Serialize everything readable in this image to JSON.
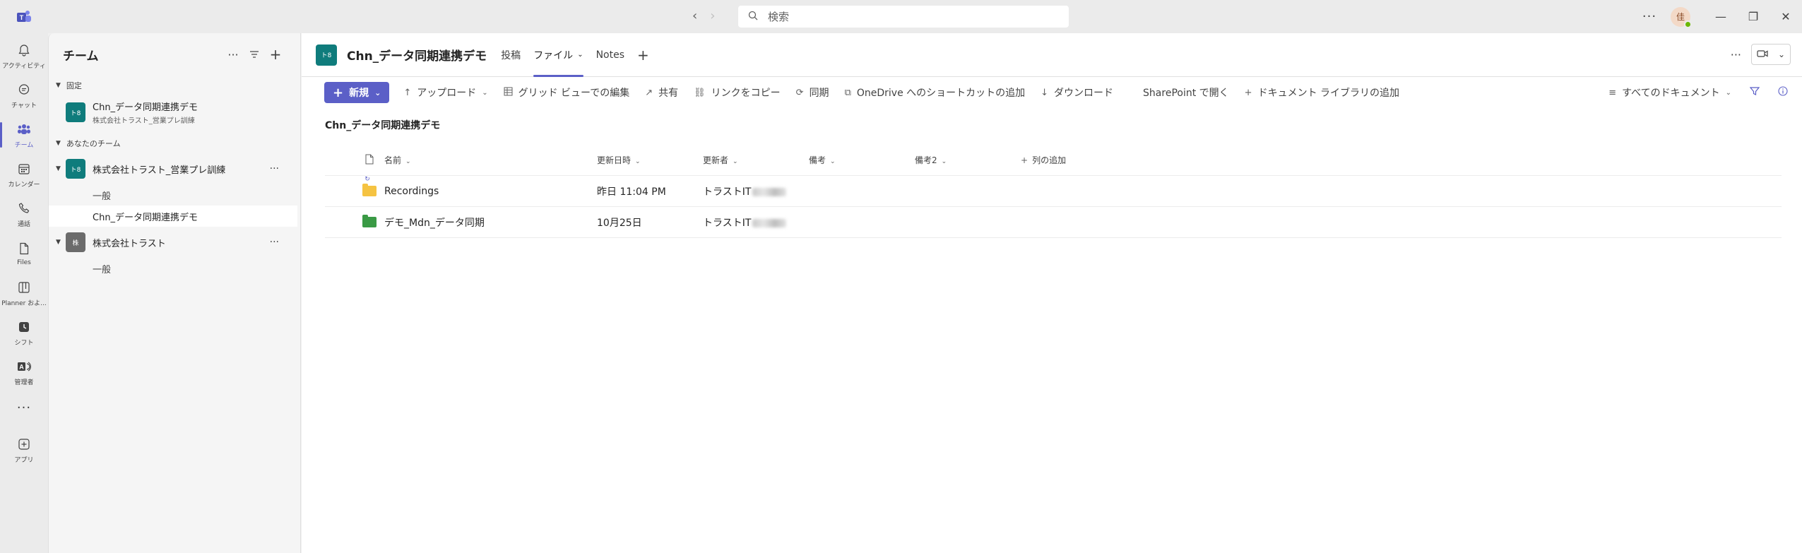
{
  "titlebar": {
    "search_placeholder": "検索",
    "avatar_initial": "佳"
  },
  "rail": [
    {
      "label": "アクティビティ",
      "icon": "bell-icon"
    },
    {
      "label": "チャット",
      "icon": "chat-icon"
    },
    {
      "label": "チーム",
      "icon": "teams-icon",
      "active": true
    },
    {
      "label": "カレンダー",
      "icon": "calendar-icon"
    },
    {
      "label": "通話",
      "icon": "phone-icon"
    },
    {
      "label": "Files",
      "icon": "file-icon"
    },
    {
      "label": "Planner およ...",
      "icon": "planner-icon"
    },
    {
      "label": "シフト",
      "icon": "shifts-icon"
    },
    {
      "label": "管理者",
      "icon": "admin-icon"
    },
    {
      "label": "",
      "icon": "more-icon"
    },
    {
      "label": "アプリ",
      "icon": "apps-icon"
    }
  ],
  "teams_panel": {
    "title": "チーム",
    "pinned_label": "固定",
    "pinned": {
      "avatar": "ト8",
      "name": "Chn_データ同期連携デモ",
      "sub": "株式会社トラスト_営業プレ訓練"
    },
    "your_teams_label": "あなたのチーム",
    "teams": [
      {
        "avatar": "ト8",
        "name": "株式会社トラスト_営業プレ訓練",
        "channels": [
          "一般",
          "Chn_データ同期連携デモ"
        ]
      },
      {
        "avatar": "株",
        "name": "株式会社トラスト",
        "channels": [
          "一般"
        ]
      }
    ]
  },
  "channel": {
    "avatar": "ト8",
    "title": "Chn_データ同期連携デモ",
    "tabs": [
      "投稿",
      "ファイル",
      "Notes"
    ],
    "active_tab": "ファイル"
  },
  "commands": {
    "new": "新規",
    "upload": "アップロード",
    "grid_edit": "グリッド ビューでの編集",
    "share": "共有",
    "copy_link": "リンクをコピー",
    "sync": "同期",
    "onedrive_shortcut": "OneDrive へのショートカットの追加",
    "download": "ダウンロード",
    "open_sharepoint": "SharePoint で開く",
    "add_library": "ドキュメント ライブラリの追加",
    "view": "すべてのドキュメント"
  },
  "library": {
    "title": "Chn_データ同期連携デモ",
    "columns": {
      "name": "名前",
      "modified": "更新日時",
      "modified_by": "更新者",
      "note1": "備考",
      "note2": "備考2",
      "add_column": "列の追加"
    },
    "rows": [
      {
        "name": "Recordings",
        "modified": "昨日 11:04 PM",
        "modified_by": "トラストIT",
        "folder_color": "#f5c342"
      },
      {
        "name": "デモ_Mdn_データ同期",
        "modified": "10月25日",
        "modified_by": "トラストIT",
        "folder_color": "#3a9a45"
      }
    ]
  },
  "colors": {
    "accent": "#5b5fc7",
    "team_avatar": "#0f7c7c"
  }
}
